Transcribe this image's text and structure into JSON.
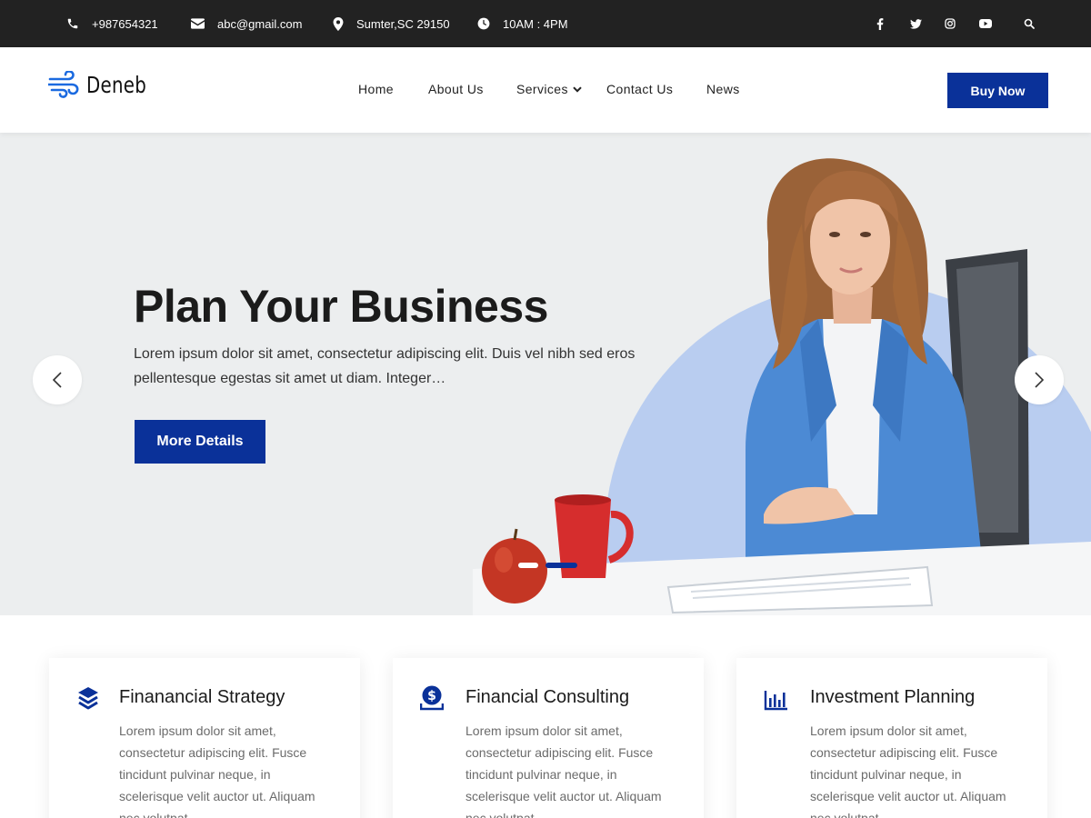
{
  "topbar": {
    "phone": "+987654321",
    "email": "abc@gmail.com",
    "address": "Sumter,SC 29150",
    "hours": "10AM : 4PM",
    "icons": [
      "phone-icon",
      "envelope-icon",
      "map-pin-icon",
      "clock-icon"
    ],
    "social": [
      "facebook-icon",
      "twitter-icon",
      "instagram-icon",
      "youtube-icon",
      "search-icon"
    ]
  },
  "header": {
    "logo_text": "Deneb",
    "nav": [
      "Home",
      "About Us",
      "Services",
      "Contact Us",
      "News"
    ],
    "buy_label": "Buy Now"
  },
  "hero": {
    "title": "Plan Your Business",
    "text": "Lorem ipsum dolor sit amet, consectetur adipiscing elit. Duis vel nibh sed eros pellentesque egestas sit amet ut diam. Integer…",
    "button_label": "More Details",
    "slides": 2,
    "active_slide": 2
  },
  "cards": [
    {
      "icon": "layers-icon",
      "title": "Finanancial Strategy",
      "text": "Lorem ipsum dolor sit amet, consectetur adipiscing elit. Fusce tincidunt pulvinar neque, in scelerisque velit auctor ut. Aliquam nec volutpat"
    },
    {
      "icon": "dollar-coin-icon",
      "title": "Financial Consulting",
      "text": "Lorem ipsum dolor sit amet, consectetur adipiscing elit. Fusce tincidunt pulvinar neque, in scelerisque velit auctor ut. Aliquam nec volutpat"
    },
    {
      "icon": "bar-chart-icon",
      "title": "Investment Planning",
      "text": "Lorem ipsum dolor sit amet, consectetur adipiscing elit. Fusce tincidunt pulvinar neque, in scelerisque velit auctor ut. Aliquam nec volutpat"
    }
  ],
  "colors": {
    "primary": "#0a3199",
    "topbar": "#222222",
    "hero_bg": "#eceeef",
    "accent_circle": "#b9cdf0"
  }
}
